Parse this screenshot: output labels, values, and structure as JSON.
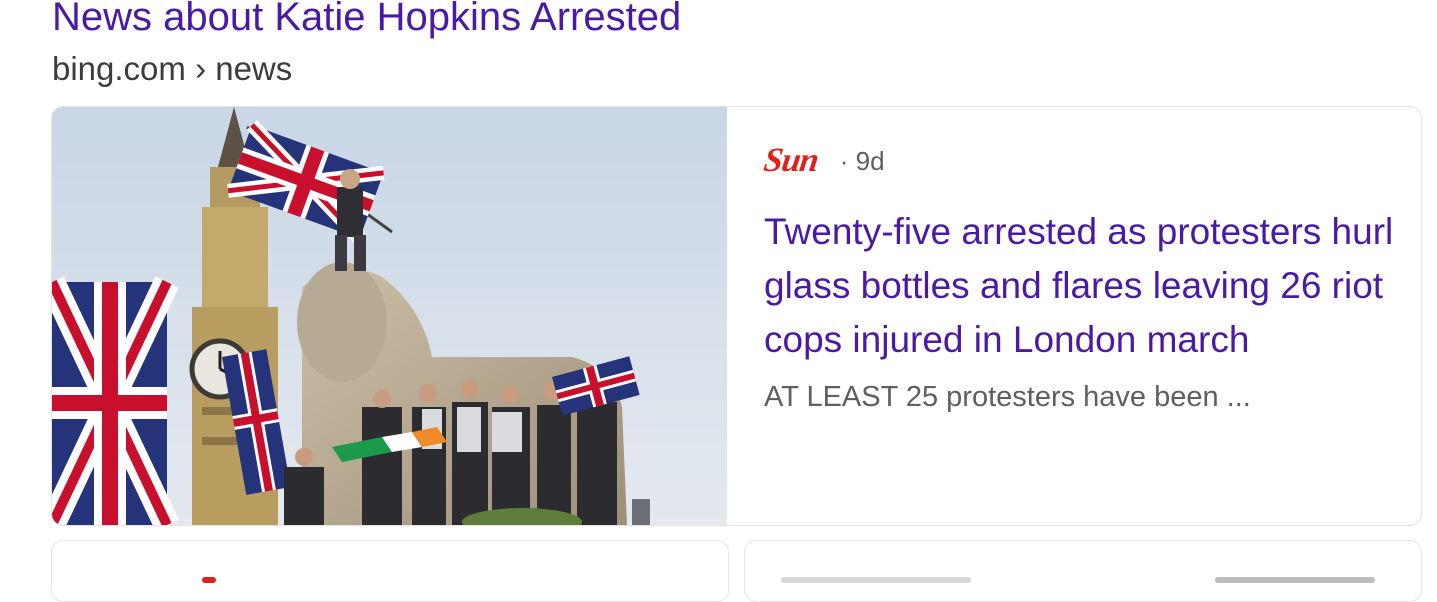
{
  "section": {
    "heading": "News about Katie Hopkins Arrested",
    "breadcrumb": "bing.com › news"
  },
  "article": {
    "source_logo_text": "Sun",
    "age": "· 9d",
    "headline": "Twenty-five arrested as protesters hurl glass bottles and flares leaving 26 riot cops injured in London march",
    "snippet": "AT LEAST 25 protesters have been ..."
  },
  "colors": {
    "link": "#4a1aa6",
    "sun_red": "#e0201b",
    "meta_gray": "#5f5f5f"
  }
}
